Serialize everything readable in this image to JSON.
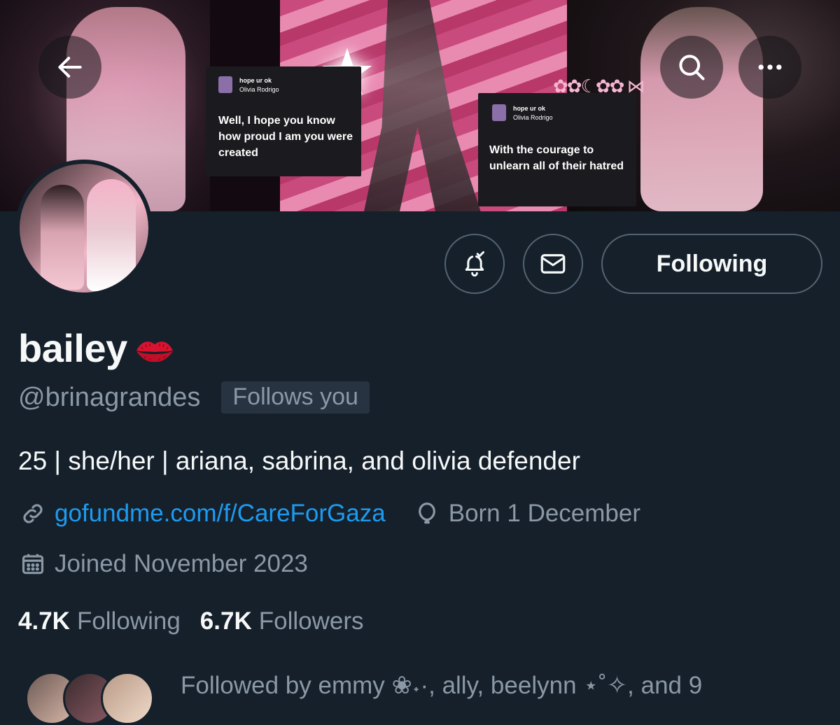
{
  "banner": {
    "card1": {
      "song": "hope ur ok",
      "artist": "Olivia Rodrigo",
      "lyric": "Well, I hope you know how proud I am you were created"
    },
    "card2": {
      "song": "hope ur ok",
      "artist": "Olivia Rodrigo",
      "lyric": "With the courage to unlearn all of their hatred"
    }
  },
  "header": {
    "back_icon": "arrow-left-icon",
    "search_icon": "search-icon",
    "more_icon": "more-horizontal-icon"
  },
  "actions": {
    "notify_icon": "bell-check-icon",
    "message_icon": "envelope-icon",
    "following_label": "Following"
  },
  "profile": {
    "display_name": "bailey",
    "name_emoji": "lips-icon",
    "handle": "@brinagrandes",
    "follows_you": "Follows you",
    "bio": "25 | she/her | ariana, sabrina, and olivia defender",
    "link": "gofundme.com/f/CareForGaza",
    "birthday": "Born 1 December",
    "joined": "Joined November 2023"
  },
  "stats": {
    "following_count": "4.7K",
    "following_label": "Following",
    "followers_count": "6.7K",
    "followers_label": "Followers"
  },
  "followed_by": "Followed by emmy ❀˖·, ally, beelynn ⋆˚✧, and 9",
  "colors": {
    "background": "#15202b",
    "muted": "#8b98a5",
    "link": "#1d9bf0",
    "border": "#536471"
  }
}
